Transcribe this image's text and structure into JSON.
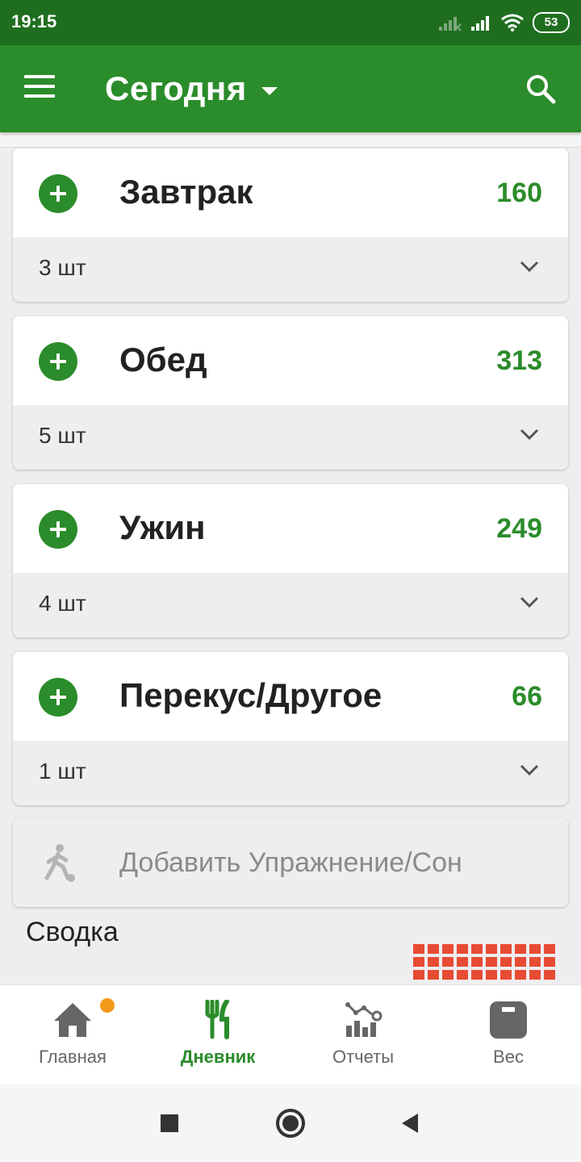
{
  "status_bar": {
    "time": "19:15",
    "battery": "53",
    "icons": [
      "signal-off-icon",
      "signal-icon",
      "wifi-icon",
      "battery-icon"
    ]
  },
  "app_bar": {
    "title": "Сегодня",
    "icons": [
      "menu-icon",
      "dropdown-caret-icon",
      "search-icon"
    ],
    "color": "#2a8c2a"
  },
  "meals": [
    {
      "name": "Завтрак",
      "calories": "160",
      "count": "3 шт"
    },
    {
      "name": "Обед",
      "calories": "313",
      "count": "5 шт"
    },
    {
      "name": "Ужин",
      "calories": "249",
      "count": "4 шт"
    },
    {
      "name": "Перекус/Другое",
      "calories": "66",
      "count": "1 шт"
    }
  ],
  "exercise": {
    "label": "Добавить Упражнение/Сон",
    "icon": "running-person-icon"
  },
  "summary": {
    "label": "Сводка",
    "accent_color": "#e84b33"
  },
  "bottom_nav": {
    "items": [
      {
        "label": "Главная",
        "icon": "home-icon",
        "active": false,
        "badge": true
      },
      {
        "label": "Дневник",
        "icon": "fork-knife-icon",
        "active": true
      },
      {
        "label": "Отчеты",
        "icon": "chart-icon",
        "active": false
      },
      {
        "label": "Вес",
        "icon": "scale-icon",
        "active": false
      }
    ],
    "active_color": "#2a8c2a",
    "badge_color": "#f39a1b"
  },
  "system_nav": {
    "icons": [
      "recent-apps-icon",
      "home-circle-icon",
      "back-icon"
    ]
  }
}
